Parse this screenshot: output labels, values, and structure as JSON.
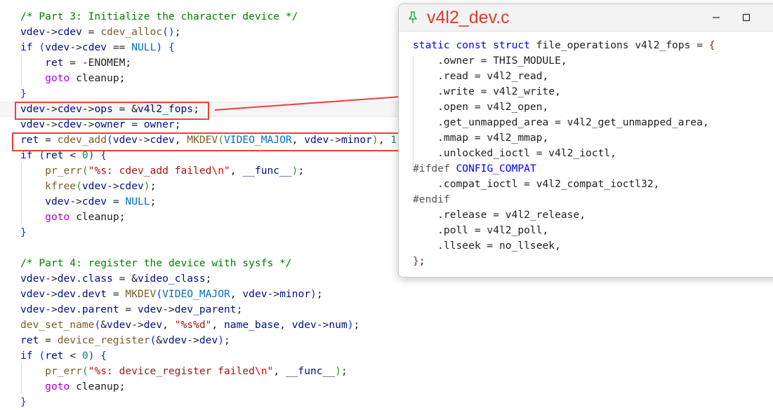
{
  "editor": {
    "lines": [
      [
        [
          "c",
          "/* Part 3: Initialize the character device */"
        ]
      ],
      [
        [
          "v",
          "vdev"
        ],
        [
          "p",
          "->"
        ],
        [
          "v",
          "cdev"
        ],
        [
          "p",
          " = "
        ],
        [
          "f",
          "cdev_alloc"
        ],
        [
          "b1",
          "()"
        ],
        [
          "p",
          ";"
        ]
      ],
      [
        [
          "k",
          "if"
        ],
        [
          "p",
          " "
        ],
        [
          "b1",
          "("
        ],
        [
          "v",
          "vdev"
        ],
        [
          "p",
          "->"
        ],
        [
          "v",
          "cdev"
        ],
        [
          "p",
          " == "
        ],
        [
          "m",
          "NULL"
        ],
        [
          "b1",
          ")"
        ],
        [
          "p",
          " "
        ],
        [
          "b1",
          "{"
        ]
      ],
      [
        [
          "p",
          "    "
        ],
        [
          "v",
          "ret"
        ],
        [
          "p",
          " = -ENOMEM;"
        ]
      ],
      [
        [
          "p",
          "    "
        ],
        [
          "k2",
          "goto"
        ],
        [
          "p",
          " cleanup;"
        ]
      ],
      [
        [
          "b1",
          "}"
        ]
      ],
      [
        [
          "v",
          "vdev"
        ],
        [
          "p",
          "->"
        ],
        [
          "v",
          "cdev"
        ],
        [
          "p",
          "->"
        ],
        [
          "v",
          "ops"
        ],
        [
          "p",
          " = &"
        ],
        [
          "v",
          "v4l2_fops"
        ],
        [
          "p",
          ";"
        ]
      ],
      [
        [
          "v",
          "vdev"
        ],
        [
          "p",
          "->"
        ],
        [
          "v",
          "cdev"
        ],
        [
          "p",
          "->"
        ],
        [
          "v",
          "owner"
        ],
        [
          "p",
          " = "
        ],
        [
          "v",
          "owner"
        ],
        [
          "p",
          ";"
        ]
      ],
      [
        [
          "v",
          "ret"
        ],
        [
          "p",
          " = "
        ],
        [
          "f",
          "cdev_add"
        ],
        [
          "b1",
          "("
        ],
        [
          "v",
          "vdev"
        ],
        [
          "p",
          "->"
        ],
        [
          "v",
          "cdev"
        ],
        [
          "p",
          ", "
        ],
        [
          "f",
          "MKDEV"
        ],
        [
          "b2",
          "("
        ],
        [
          "m",
          "VIDEO_MAJOR"
        ],
        [
          "p",
          ", "
        ],
        [
          "v",
          "vdev"
        ],
        [
          "p",
          "->"
        ],
        [
          "v",
          "minor"
        ],
        [
          "b2",
          ")"
        ],
        [
          "p",
          ", "
        ],
        [
          "n",
          "1"
        ]
      ],
      [
        [
          "k",
          "if"
        ],
        [
          "p",
          " "
        ],
        [
          "b1",
          "("
        ],
        [
          "v",
          "ret"
        ],
        [
          "p",
          " < "
        ],
        [
          "n",
          "0"
        ],
        [
          "b1",
          ")"
        ],
        [
          "p",
          " "
        ],
        [
          "b1",
          "{"
        ]
      ],
      [
        [
          "p",
          "    "
        ],
        [
          "f",
          "pr_err"
        ],
        [
          "b2",
          "("
        ],
        [
          "s",
          "\"%s: cdev_add failed"
        ],
        [
          "e",
          "\\n"
        ],
        [
          "s",
          "\""
        ],
        [
          "p",
          ", "
        ],
        [
          "v",
          "__func__"
        ],
        [
          "b2",
          ")"
        ],
        [
          "p",
          ";"
        ]
      ],
      [
        [
          "p",
          "    "
        ],
        [
          "f",
          "kfree"
        ],
        [
          "b2",
          "("
        ],
        [
          "v",
          "vdev"
        ],
        [
          "p",
          "->"
        ],
        [
          "v",
          "cdev"
        ],
        [
          "b2",
          ")"
        ],
        [
          "p",
          ";"
        ]
      ],
      [
        [
          "p",
          "    "
        ],
        [
          "v",
          "vdev"
        ],
        [
          "p",
          "->"
        ],
        [
          "v",
          "cdev"
        ],
        [
          "p",
          " = "
        ],
        [
          "m",
          "NULL"
        ],
        [
          "p",
          ";"
        ]
      ],
      [
        [
          "p",
          "    "
        ],
        [
          "k2",
          "goto"
        ],
        [
          "p",
          " cleanup;"
        ]
      ],
      [
        [
          "b1",
          "}"
        ]
      ],
      [],
      [
        [
          "c",
          "/* Part 4: register the device with sysfs */"
        ]
      ],
      [
        [
          "v",
          "vdev"
        ],
        [
          "p",
          "->"
        ],
        [
          "v",
          "dev"
        ],
        [
          "p",
          "."
        ],
        [
          "v",
          "class"
        ],
        [
          "p",
          " = &"
        ],
        [
          "v",
          "video_class"
        ],
        [
          "p",
          ";"
        ]
      ],
      [
        [
          "v",
          "vdev"
        ],
        [
          "p",
          "->"
        ],
        [
          "v",
          "dev"
        ],
        [
          "p",
          "."
        ],
        [
          "v",
          "devt"
        ],
        [
          "p",
          " = "
        ],
        [
          "f",
          "MKDEV"
        ],
        [
          "b1",
          "("
        ],
        [
          "m",
          "VIDEO_MAJOR"
        ],
        [
          "p",
          ", "
        ],
        [
          "v",
          "vdev"
        ],
        [
          "p",
          "->"
        ],
        [
          "v",
          "minor"
        ],
        [
          "b1",
          ")"
        ],
        [
          "p",
          ";"
        ]
      ],
      [
        [
          "v",
          "vdev"
        ],
        [
          "p",
          "->"
        ],
        [
          "v",
          "dev"
        ],
        [
          "p",
          "."
        ],
        [
          "v",
          "parent"
        ],
        [
          "p",
          " = "
        ],
        [
          "v",
          "vdev"
        ],
        [
          "p",
          "->"
        ],
        [
          "v",
          "dev_parent"
        ],
        [
          "p",
          ";"
        ]
      ],
      [
        [
          "f",
          "dev_set_name"
        ],
        [
          "b1",
          "("
        ],
        [
          "p",
          "&"
        ],
        [
          "v",
          "vdev"
        ],
        [
          "p",
          "->"
        ],
        [
          "v",
          "dev"
        ],
        [
          "p",
          ", "
        ],
        [
          "s",
          "\"%s%d\""
        ],
        [
          "p",
          ", "
        ],
        [
          "v",
          "name_base"
        ],
        [
          "p",
          ", "
        ],
        [
          "v",
          "vdev"
        ],
        [
          "p",
          "->"
        ],
        [
          "v",
          "num"
        ],
        [
          "b1",
          ")"
        ],
        [
          "p",
          ";"
        ]
      ],
      [
        [
          "v",
          "ret"
        ],
        [
          "p",
          " = "
        ],
        [
          "f",
          "device_register"
        ],
        [
          "b1",
          "("
        ],
        [
          "p",
          "&"
        ],
        [
          "v",
          "vdev"
        ],
        [
          "p",
          "->"
        ],
        [
          "v",
          "dev"
        ],
        [
          "b1",
          ")"
        ],
        [
          "p",
          ";"
        ]
      ],
      [
        [
          "k",
          "if"
        ],
        [
          "p",
          " "
        ],
        [
          "b1",
          "("
        ],
        [
          "v",
          "ret"
        ],
        [
          "p",
          " < "
        ],
        [
          "n",
          "0"
        ],
        [
          "b1",
          ")"
        ],
        [
          "p",
          " "
        ],
        [
          "b1",
          "{"
        ]
      ],
      [
        [
          "p",
          "    "
        ],
        [
          "f",
          "pr_err"
        ],
        [
          "b2",
          "("
        ],
        [
          "s",
          "\"%s: device_register failed"
        ],
        [
          "e",
          "\\n"
        ],
        [
          "s",
          "\""
        ],
        [
          "p",
          ", "
        ],
        [
          "v",
          "__func__"
        ],
        [
          "b2",
          ")"
        ],
        [
          "p",
          ";"
        ]
      ],
      [
        [
          "p",
          "    "
        ],
        [
          "k2",
          "goto"
        ],
        [
          "p",
          " cleanup;"
        ]
      ],
      [
        [
          "b1",
          "}"
        ]
      ]
    ]
  },
  "peek": {
    "title": "v4l2_dev.c",
    "pin_icon": "pin-icon",
    "minimize_icon": "minimize-icon",
    "maximize_icon": "maximize-icon",
    "lines": [
      [
        [
          "k",
          "static"
        ],
        [
          "p",
          " "
        ],
        [
          "k",
          "const"
        ],
        [
          "p",
          " "
        ],
        [
          "k",
          "struct"
        ],
        [
          "p",
          " file_operations v4l2_fops = "
        ],
        [
          "b3",
          "{"
        ]
      ],
      [
        [
          "p",
          "    .owner = THIS_MODULE,"
        ]
      ],
      [
        [
          "p",
          "    .read = v4l2_read,"
        ]
      ],
      [
        [
          "p",
          "    .write = v4l2_write,"
        ]
      ],
      [
        [
          "p",
          "    .open = v4l2_open,"
        ]
      ],
      [
        [
          "p",
          "    .get_unmapped_area = v4l2_get_unmapped_area,"
        ]
      ],
      [
        [
          "p",
          "    .mmap = v4l2_mmap,"
        ]
      ],
      [
        [
          "p",
          "    .unlocked_ioctl = v4l2_ioctl,"
        ]
      ],
      [
        [
          "pp",
          "#ifdef"
        ],
        [
          "p",
          " "
        ],
        [
          "k",
          "CONFIG_COMPAT"
        ]
      ],
      [
        [
          "p",
          "    .compat_ioctl = v4l2_compat_ioctl32,"
        ]
      ],
      [
        [
          "pp",
          "#endif"
        ]
      ],
      [
        [
          "p",
          "    .release = v4l2_release,"
        ]
      ],
      [
        [
          "p",
          "    .poll = v4l2_poll,"
        ]
      ],
      [
        [
          "p",
          "    .llseek = no_llseek,"
        ]
      ],
      [
        [
          "b3",
          "}"
        ],
        [
          "p",
          ";"
        ]
      ]
    ]
  },
  "annotations": {
    "accent_color": "#e8413a",
    "boxes": [
      "ops-assignment-highlight",
      "cdev-add-highlight"
    ]
  }
}
